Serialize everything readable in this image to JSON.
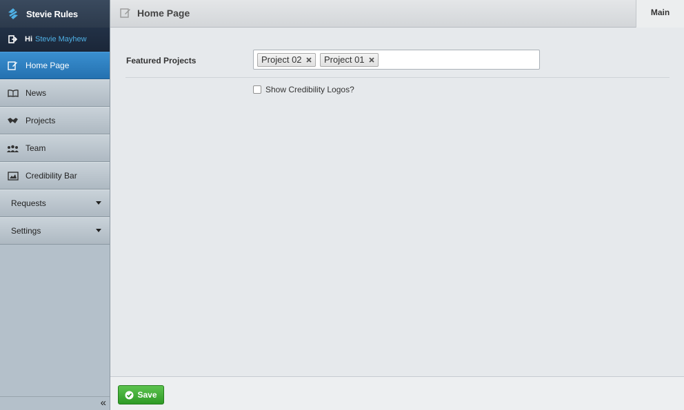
{
  "app": {
    "brand": "Stevie Rules"
  },
  "user": {
    "greeting": "Hi",
    "name": "Stevie Mayhew"
  },
  "sidebar": {
    "items": [
      {
        "label": "Home Page",
        "icon": "edit-icon",
        "active": true
      },
      {
        "label": "News",
        "icon": "book-icon"
      },
      {
        "label": "Projects",
        "icon": "handshake-icon"
      },
      {
        "label": "Team",
        "icon": "team-icon"
      },
      {
        "label": "Credibility Bar",
        "icon": "image-icon"
      },
      {
        "label": "Requests",
        "icon": "chevron-down-icon",
        "dropdown": true
      },
      {
        "label": "Settings",
        "icon": "chevron-down-icon",
        "dropdown": true
      }
    ],
    "collapse_label": "«"
  },
  "header": {
    "title": "Home Page",
    "tab": "Main"
  },
  "form": {
    "featured_label": "Featured Projects",
    "featured_tags": [
      "Project 02",
      "Project 01"
    ],
    "credibility_label": "Show Credibility Logos?",
    "credibility_checked": false
  },
  "footer": {
    "save_label": "Save"
  },
  "colors": {
    "accent": "#2a7cc0",
    "save": "#3aa52f",
    "user_link": "#4fb1e6"
  }
}
